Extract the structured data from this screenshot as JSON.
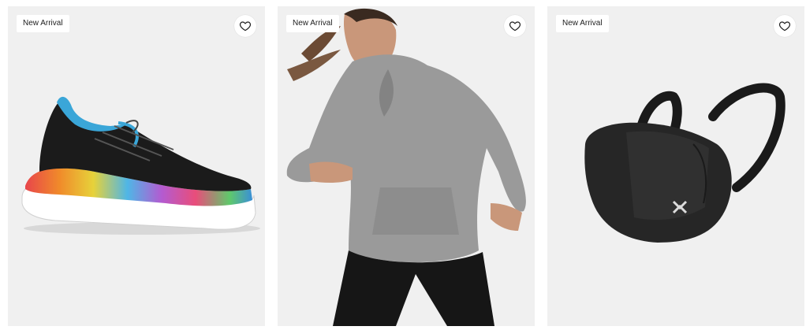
{
  "products": [
    {
      "badge": "New Arrival",
      "image_icon": "basketball-shoe-image",
      "favorite_icon": "heart-icon"
    },
    {
      "badge": "New Arrival",
      "image_icon": "hoodie-model-image",
      "favorite_icon": "heart-icon"
    },
    {
      "badge": "New Arrival",
      "image_icon": "sports-mask-image",
      "favorite_icon": "heart-icon"
    }
  ],
  "colors": {
    "card_bg": "#f0f0f0",
    "badge_bg": "#ffffff",
    "text": "#1d1d1d"
  }
}
